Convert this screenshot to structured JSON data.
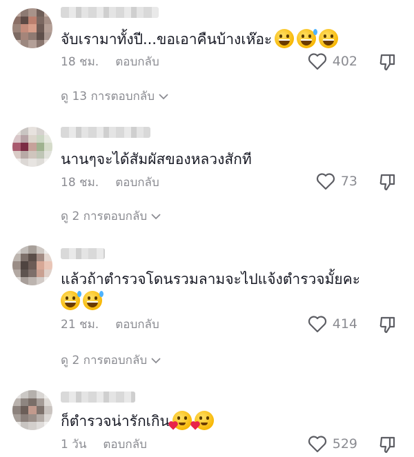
{
  "comments": [
    {
      "text": "จับเรามาทั้งปี...ขอเอาคืนบ้างเห๊อะ",
      "emojis": [
        "grinning-face-icon",
        "grinning-face-with-sweat-icon",
        "face-with-tears-of-joy-icon"
      ],
      "time": "18 ชม.",
      "reply_label": "ตอบกลับ",
      "likes": "402",
      "view_replies": "ดู 13 การตอบกลับ"
    },
    {
      "text": "นานๆจะได้สัมผัสของหลวงสักที",
      "emojis": [],
      "time": "18 ชม.",
      "reply_label": "ตอบกลับ",
      "likes": "73",
      "view_replies": "ดู 2 การตอบกลับ"
    },
    {
      "text": "แล้วถ้าตำรวจโดนรวมลามจะไปแจ้งตำรวจมั้ยคะ",
      "emojis": [
        "grinning-face-with-sweat-icon",
        "grinning-face-with-sweat-icon"
      ],
      "time": "21 ชม.",
      "reply_label": "ตอบกลับ",
      "likes": "414",
      "view_replies": "ดู 2 การตอบกลับ"
    },
    {
      "text": "ก็ตำรวจน่ารักเกิน",
      "emojis": [
        "smiling-face-with-hearts-icon",
        "smiling-face-with-hearts-icon"
      ],
      "time": "1 วัน",
      "reply_label": "ตอบกลับ",
      "likes": "529"
    }
  ],
  "colors": {
    "text": "#161823",
    "muted": "#8a8b91",
    "background": "#ffffff"
  }
}
